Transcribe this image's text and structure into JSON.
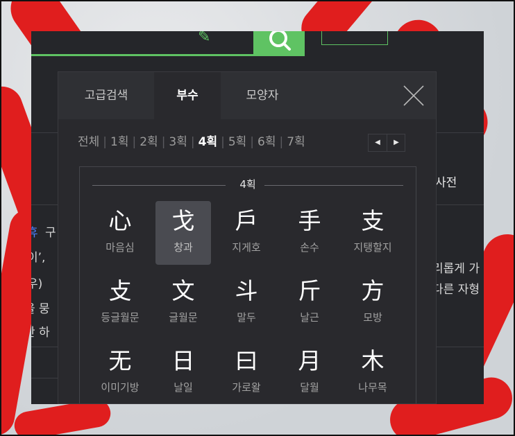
{
  "colors": {
    "accent": "#5fc363",
    "panel": "#29292d",
    "text": "#ffffff",
    "muted": "#a2a2a2"
  },
  "background_page": {
    "dict_label": "사전",
    "fragments": [
      {
        "text": "휴 ",
        "blue": true
      },
      {
        "text": "구"
      },
      {
        "text": "이’, "
      },
      {
        "text": "우)"
      },
      {
        "text": "을 뭉"
      },
      {
        "text": "만 하"
      },
      {
        "text": "리롭게 가"
      },
      {
        "text": "다른 자형"
      }
    ]
  },
  "tabs": [
    {
      "label": "고급검색",
      "active": false
    },
    {
      "label": "부수",
      "active": true
    },
    {
      "label": "모양자",
      "active": false
    }
  ],
  "strokes": [
    {
      "label": "전체",
      "active": false
    },
    {
      "label": "1획",
      "active": false
    },
    {
      "label": "2획",
      "active": false
    },
    {
      "label": "3획",
      "active": false
    },
    {
      "label": "4획",
      "active": true
    },
    {
      "label": "5획",
      "active": false
    },
    {
      "label": "6획",
      "active": false
    },
    {
      "label": "7획",
      "active": false
    }
  ],
  "pager": {
    "prev": "◀",
    "next": "▶"
  },
  "section_label": "4획",
  "radicals": [
    {
      "char": "心",
      "name": "마음심",
      "selected": false
    },
    {
      "char": "戈",
      "name": "창과",
      "selected": true
    },
    {
      "char": "戶",
      "name": "지게호",
      "selected": false
    },
    {
      "char": "手",
      "name": "손수",
      "selected": false
    },
    {
      "char": "支",
      "name": "지탱할지",
      "selected": false
    },
    {
      "char": "攴",
      "name": "등글월문",
      "selected": false
    },
    {
      "char": "文",
      "name": "글월문",
      "selected": false
    },
    {
      "char": "斗",
      "name": "말두",
      "selected": false
    },
    {
      "char": "斤",
      "name": "날근",
      "selected": false
    },
    {
      "char": "方",
      "name": "모방",
      "selected": false
    },
    {
      "char": "无",
      "name": "이미기방",
      "selected": false
    },
    {
      "char": "日",
      "name": "날일",
      "selected": false
    },
    {
      "char": "曰",
      "name": "가로왈",
      "selected": false
    },
    {
      "char": "月",
      "name": "달월",
      "selected": false
    },
    {
      "char": "木",
      "name": "나무목",
      "selected": false
    }
  ]
}
